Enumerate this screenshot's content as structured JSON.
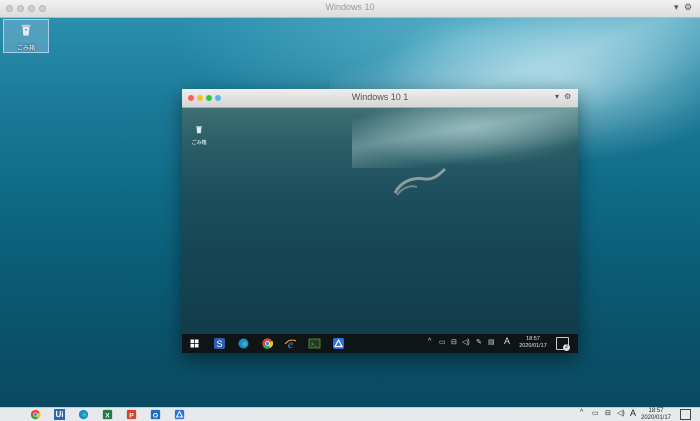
{
  "window": {
    "title": "Windows 10"
  },
  "desktop": {
    "icons": [
      {
        "label": "ごみ箱",
        "icon": "recycle-bin-icon"
      }
    ]
  },
  "vm_window": {
    "title": "Windows 10 1",
    "desktop_icons": [
      {
        "label": "ごみ箱",
        "icon": "recycle-bin-icon"
      }
    ],
    "taskbar": {
      "apps": [
        "windows-start-icon",
        "sourcetree-icon",
        "edge-icon",
        "chrome-icon",
        "ie-icon",
        "terminal-icon",
        "drive-icon"
      ],
      "tray_ime": "A",
      "time": "18:57",
      "date": "2020/01/17",
      "notifications": "2"
    }
  },
  "host_taskbar": {
    "apps": [
      "chrome-icon",
      "uipath-icon",
      "edge-icon",
      "excel-icon",
      "powerpoint-icon",
      "outlook-icon",
      "drive-icon"
    ],
    "uipath_label": "Ui",
    "tray_ime": "A",
    "time": "18:57",
    "date": "2020/01/17"
  },
  "colors": {
    "mac_red": "#fc5f57",
    "mac_yellow": "#fdbc2e",
    "mac_green": "#2ac940",
    "taskbar_dark": "#0f1416"
  }
}
